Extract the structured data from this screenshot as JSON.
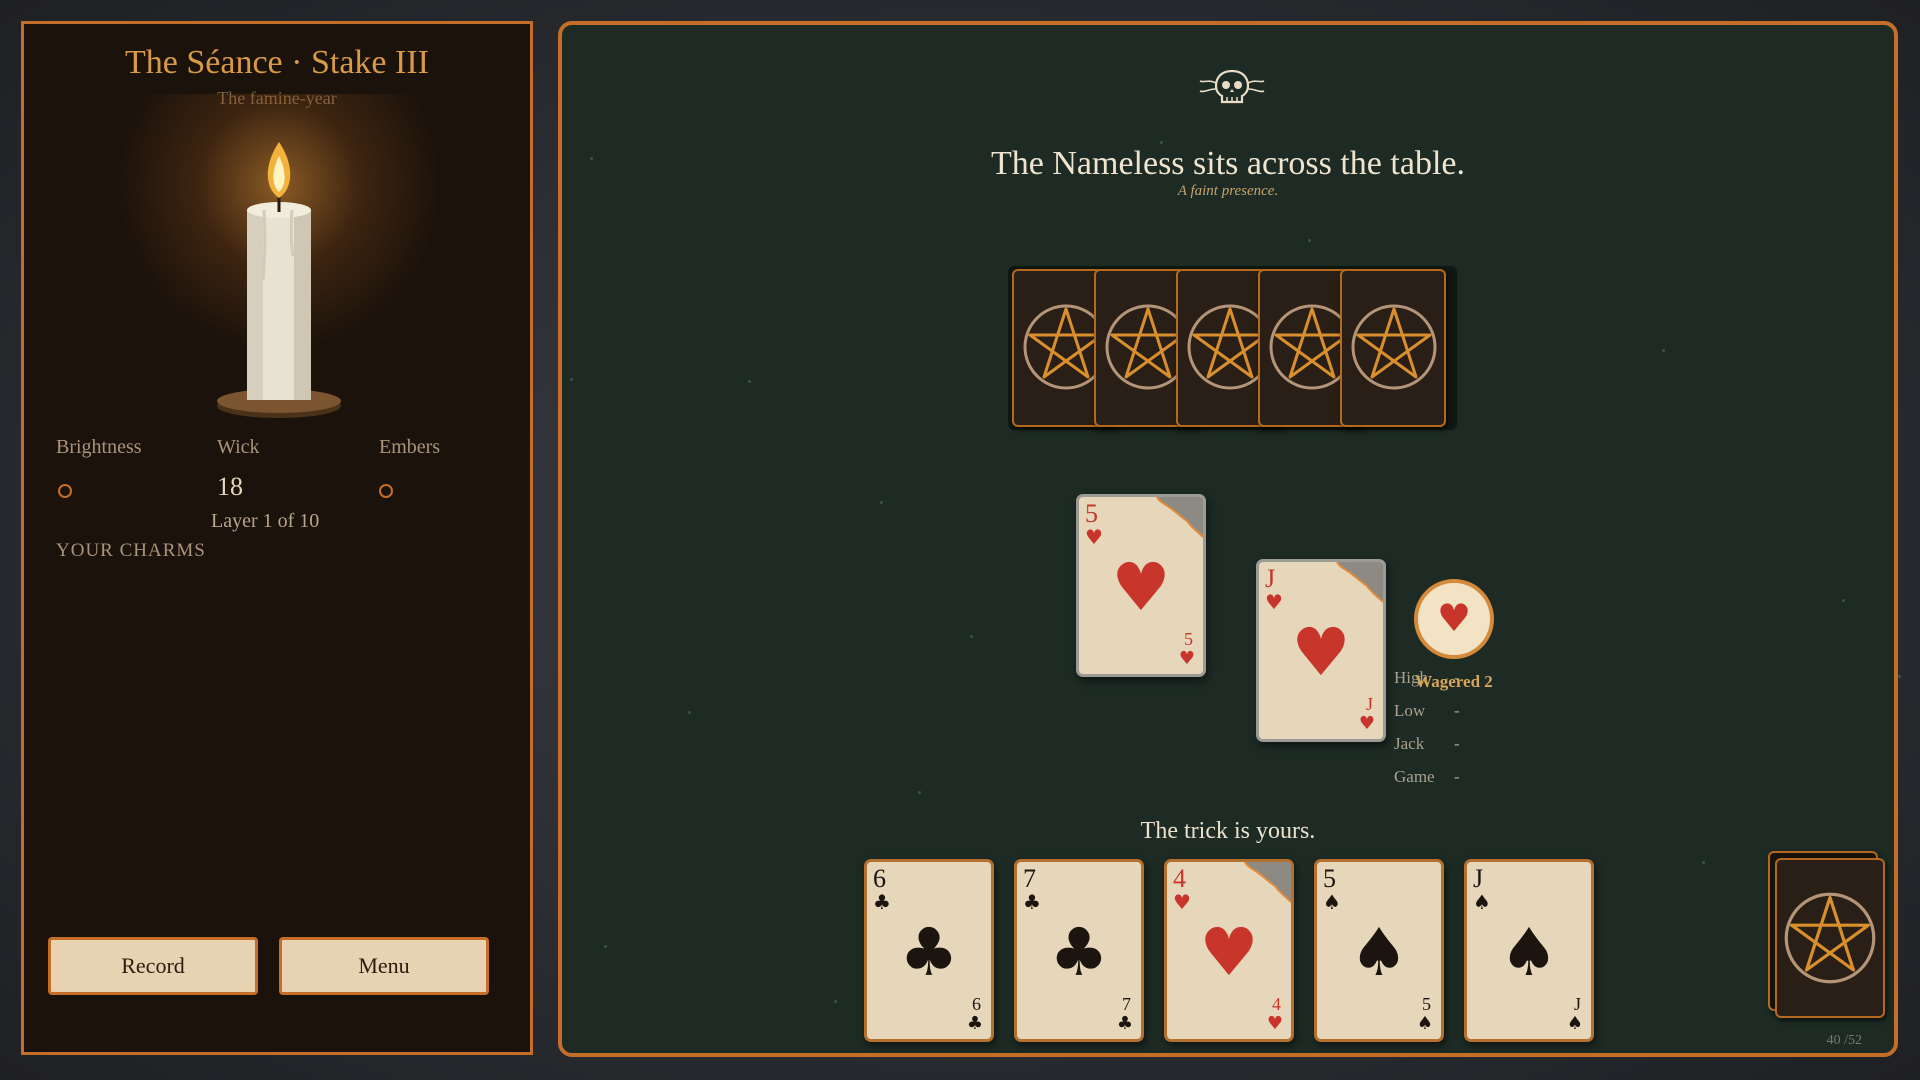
{
  "header": {
    "title": "The Séance · Stake III",
    "subtitle": "The famine-year"
  },
  "stats": {
    "brightness_label": "Brightness",
    "wick_label": "Wick",
    "embers_label": "Embers",
    "wick_value": "18",
    "layer_text": "Layer 1 of 10"
  },
  "charms_label": "YOUR CHARMS",
  "buttons": {
    "record": "Record",
    "menu": "Menu"
  },
  "opponent": {
    "title": "The Nameless sits across the table.",
    "subtitle": "A faint presence.",
    "hand_count": 5
  },
  "trick": {
    "played": [
      {
        "rank": "5",
        "suit": "♥",
        "color": "red"
      },
      {
        "rank": "J",
        "suit": "♥",
        "color": "red"
      }
    ],
    "status": "The trick is yours."
  },
  "wager": {
    "suit": "♥",
    "label": "Wagered 2"
  },
  "score": [
    {
      "label": "High",
      "value": "-"
    },
    {
      "label": "Low",
      "value": "-"
    },
    {
      "label": "Jack",
      "value": "-"
    },
    {
      "label": "Game",
      "value": "-"
    }
  ],
  "hand": [
    {
      "rank": "6",
      "suit": "♣",
      "color": "black"
    },
    {
      "rank": "7",
      "suit": "♣",
      "color": "black"
    },
    {
      "rank": "4",
      "suit": "♥",
      "color": "red"
    },
    {
      "rank": "5",
      "suit": "♠",
      "color": "black"
    },
    {
      "rank": "J",
      "suit": "♠",
      "color": "black"
    }
  ],
  "deck": {
    "count": "40 /52"
  },
  "colors": {
    "accent": "#c46e2a",
    "table": "#1d2b24",
    "panel": "#1b120b",
    "card_face": "#e6d7bb",
    "red_suit": "#c8352b"
  }
}
